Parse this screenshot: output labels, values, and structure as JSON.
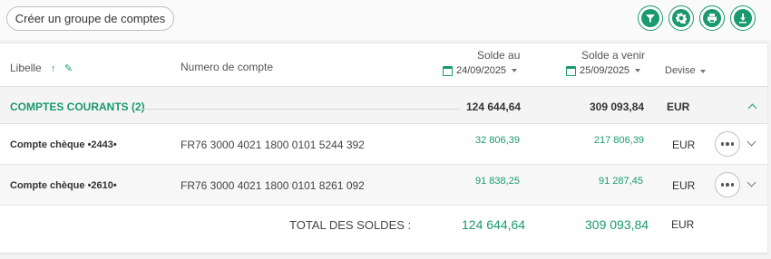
{
  "toolbar": {
    "create_group_label": "Créer un groupe de comptes",
    "icons": [
      "filter-icon",
      "gear-icon",
      "print-icon",
      "download-icon"
    ]
  },
  "table": {
    "headers": {
      "libelle": "Libelle",
      "numero": "Numero de compte",
      "solde_au": "Solde au",
      "solde_au_date": "24/09/2025",
      "solde_venir": "Solde a venir",
      "solde_venir_date": "25/09/2025",
      "devise": "Devise"
    },
    "group": {
      "title": "COMPTES COURANTS (2)",
      "solde_au": "124 644,64",
      "solde_venir": "309 093,84",
      "devise": "EUR"
    },
    "rows": [
      {
        "name": "Compte chèque •2443•",
        "number": "FR76 3000 4021 1800 0101 5244 392",
        "solde_au": "32 806,39",
        "solde_venir": "217 806,39",
        "devise": "EUR"
      },
      {
        "name": "Compte chèque •2610•",
        "number": "FR76 3000 4021 1800 0101 8261 092",
        "solde_au": "91 838,25",
        "solde_venir": "91 287,45",
        "devise": "EUR"
      }
    ],
    "total": {
      "label": "TOTAL DES SOLDES :",
      "solde_au": "124 644,64",
      "solde_venir": "309 093,84",
      "devise": "EUR"
    }
  },
  "colors": {
    "accent": "#1a9a6c"
  }
}
